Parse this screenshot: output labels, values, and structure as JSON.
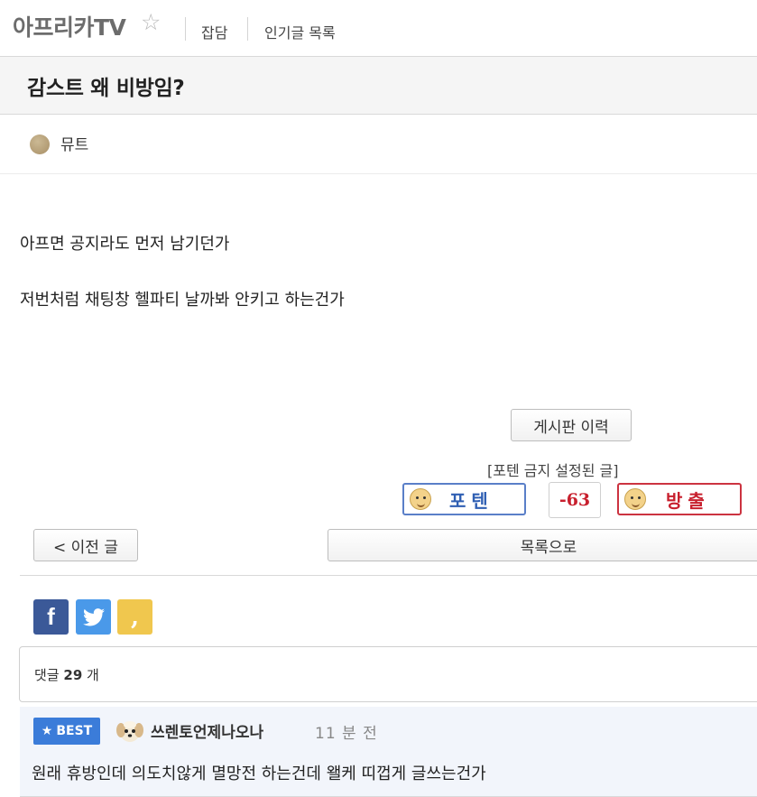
{
  "header": {
    "brand": "아프리카TV",
    "nav": [
      "잡담",
      "인기글 목록"
    ]
  },
  "post": {
    "title": "감스트 왜 비방임?",
    "author": "뮤트",
    "body": [
      "아프면 공지라도 먼저 남기던가",
      "저번처럼 채팅창 헬파티 날까봐 안키고 하는건가"
    ]
  },
  "actions": {
    "history_button": "게시판 이력",
    "notice": "[포텐 금지 설정된 글]",
    "vote_up": "포텐",
    "score": "-63",
    "vote_down": "방출",
    "prev_button": "< 이전 글",
    "list_button": "목록으로"
  },
  "share": {
    "facebook": "f",
    "kakaostory": ","
  },
  "comments": {
    "label_prefix": "댓글",
    "count": "29",
    "label_suffix": "개",
    "best": {
      "badge": "BEST",
      "author": "쓰렌토언제나오나",
      "time": "11 분 전",
      "text": "원래 휴방인데 의도치않게 멸망전 하는건데 왤케 띠껍게 글쓰는건가"
    }
  },
  "colors": {
    "vote_up": "#2f5fb3",
    "vote_down": "#c8202e",
    "best_badge": "#3b7cd9",
    "facebook": "#3b5998",
    "twitter": "#4a99e9",
    "kakaostory": "#f0c74e"
  },
  "icons": [
    "star-icon",
    "face-icon",
    "facebook-icon",
    "twitter-icon",
    "kakaostory-icon",
    "puppy-avatar-icon"
  ]
}
